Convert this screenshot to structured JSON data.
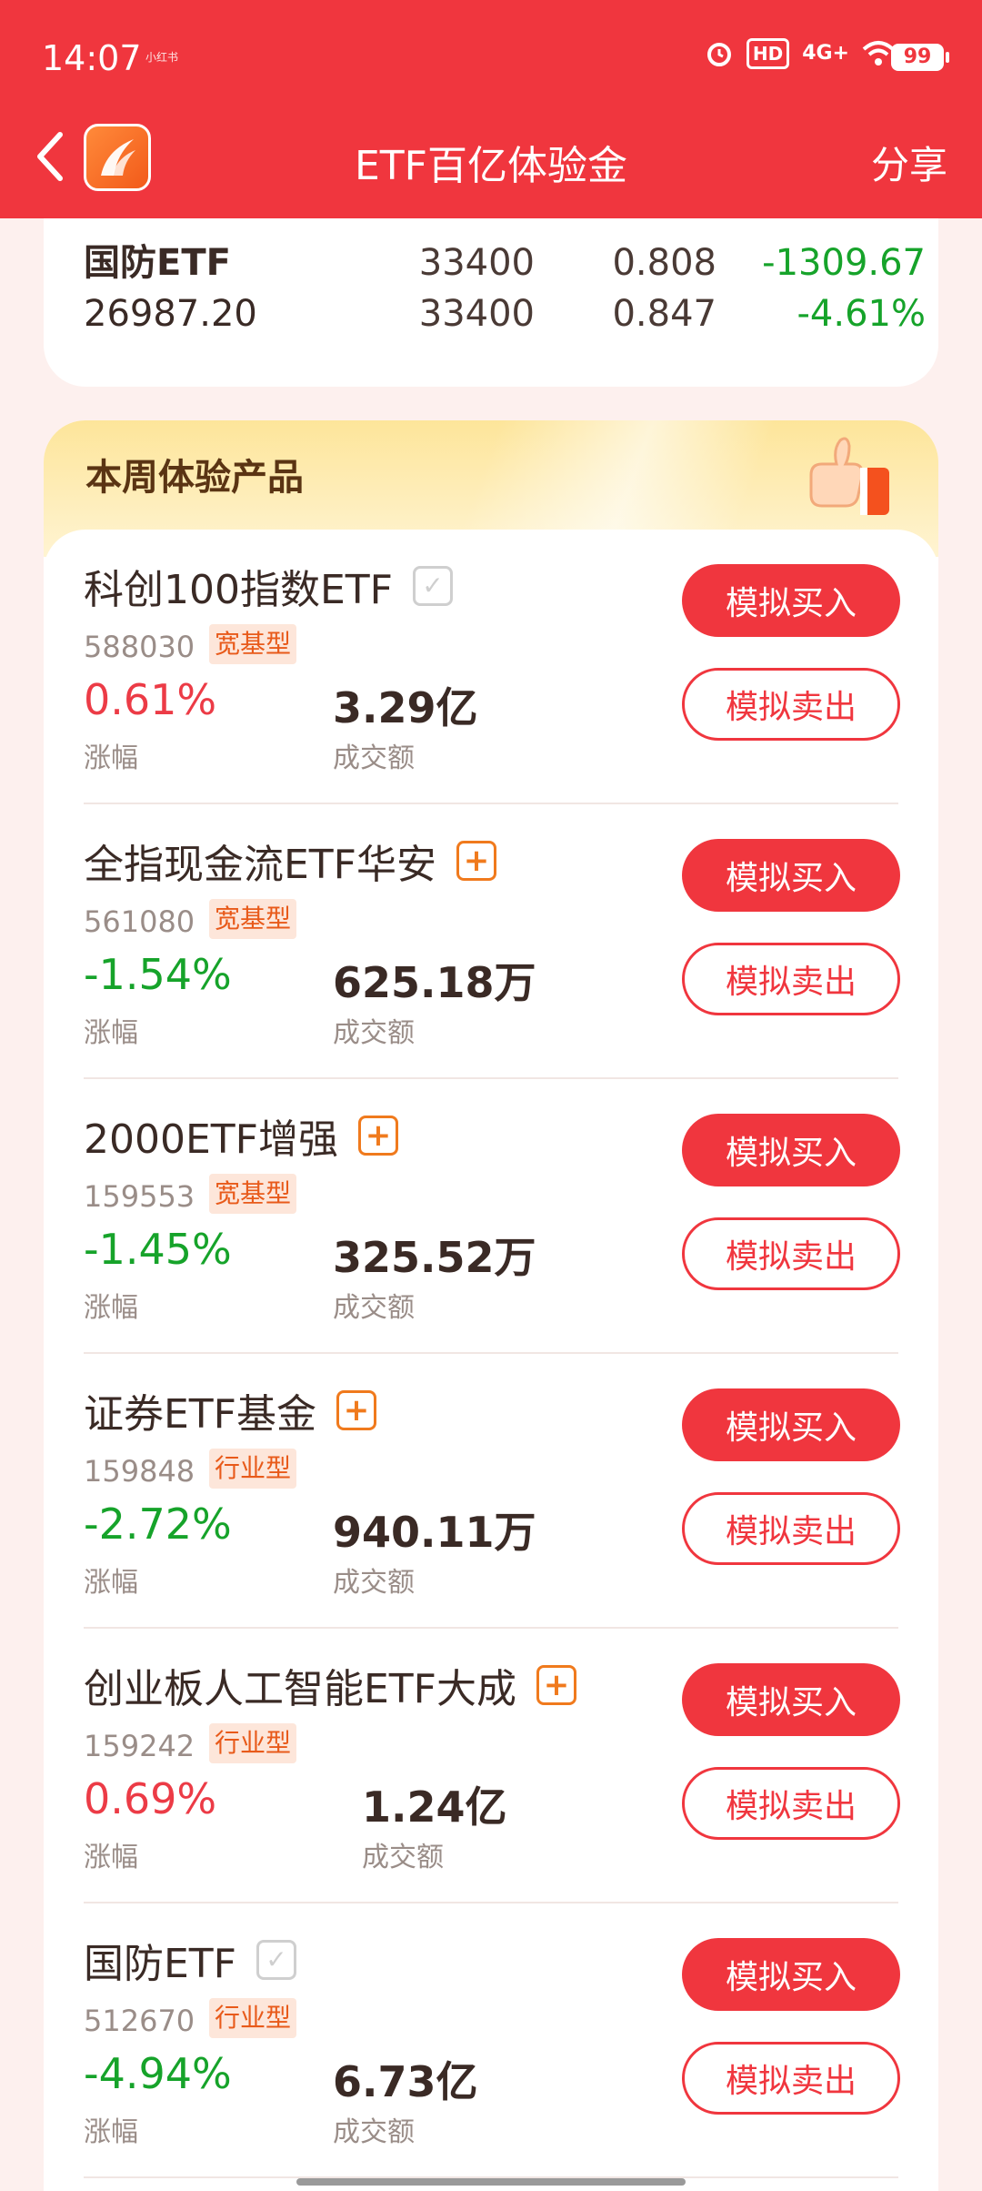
{
  "status_bar": {
    "time": "14:07",
    "tiny_text": "小红书",
    "icons": [
      "alarm-icon",
      "hd-icon",
      "4g-signal-icon",
      "wifi-icon"
    ],
    "hd": "HD",
    "network": "4G+",
    "battery": "99"
  },
  "nav": {
    "title": "ETF百亿体验金",
    "share": "分享"
  },
  "summary": {
    "name": "国防ETF",
    "value": "26987.20",
    "qty1": "33400",
    "qty2": "33400",
    "price1": "0.808",
    "price2": "0.847",
    "pl_amount": "-1309.67",
    "pl_percent": "-4.61%"
  },
  "products_section": {
    "title": "本周体验产品",
    "buy_label": "模拟买入",
    "sell_label": "模拟卖出",
    "change_label": "涨幅",
    "volume_label": "成交额",
    "items": [
      {
        "name": "科创100指数ETF",
        "code": "588030",
        "tag": "宽基型",
        "change": "0.61%",
        "volume": "3.29亿",
        "direction": "up",
        "mark": "check"
      },
      {
        "name": "全指现金流ETF华安",
        "code": "561080",
        "tag": "宽基型",
        "change": "-1.54%",
        "volume": "625.18万",
        "direction": "down",
        "mark": "plus"
      },
      {
        "name": "2000ETF增强",
        "code": "159553",
        "tag": "宽基型",
        "change": "-1.45%",
        "volume": "325.52万",
        "direction": "down",
        "mark": "plus"
      },
      {
        "name": "证券ETF基金",
        "code": "159848",
        "tag": "行业型",
        "change": "-2.72%",
        "volume": "940.11万",
        "direction": "down",
        "mark": "plus"
      },
      {
        "name": "创业板人工智能ETF大成",
        "code": "159242",
        "tag": "行业型",
        "change": "0.69%",
        "volume": "1.24亿",
        "direction": "up",
        "mark": "plus"
      },
      {
        "name": "国防ETF",
        "code": "512670",
        "tag": "行业型",
        "change": "-4.94%",
        "volume": "6.73亿",
        "direction": "down",
        "mark": "check"
      }
    ]
  },
  "colors": {
    "brand_red": "#f0363e",
    "up": "#ec3b46",
    "down": "#16a32a",
    "tag_orange": "#e85a1a"
  }
}
